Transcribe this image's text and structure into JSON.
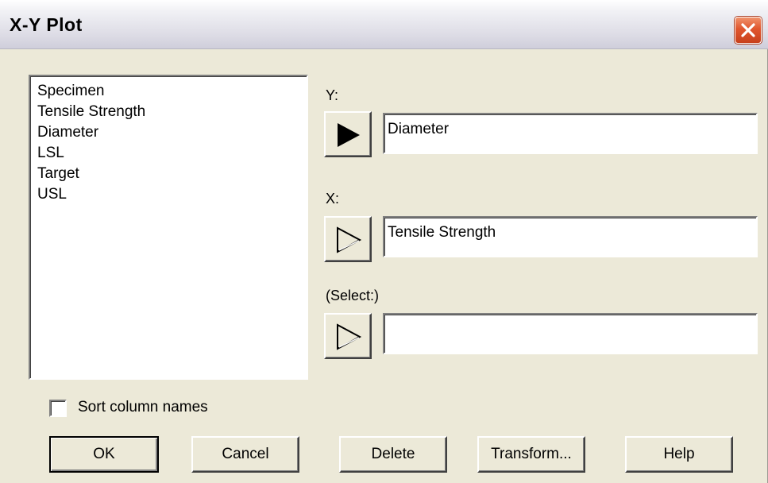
{
  "window": {
    "title": "X-Y Plot"
  },
  "column_list": {
    "items": [
      "Specimen",
      "Tensile Strength",
      "Diameter",
      "LSL",
      "Target",
      "USL"
    ]
  },
  "fields": {
    "y": {
      "label": "Y:",
      "value": "Diameter",
      "arrow_state": "filled"
    },
    "x": {
      "label": "X:",
      "value": "Tensile Strength",
      "arrow_state": "outline"
    },
    "select": {
      "label": "(Select:)",
      "value": "",
      "arrow_state": "outline"
    }
  },
  "options": {
    "sort_label": "Sort column names",
    "sort_checked": false
  },
  "buttons": {
    "ok": "OK",
    "cancel": "Cancel",
    "delete": "Delete",
    "transform": "Transform...",
    "help": "Help"
  },
  "icons": {
    "close": "close-icon",
    "arrow_filled": "play-arrow-filled-icon",
    "arrow_outline": "play-arrow-outline-icon"
  },
  "colors": {
    "dialog_bg": "#ece9d8",
    "close_button": "#e0562e",
    "field_bg": "#ffffff"
  }
}
